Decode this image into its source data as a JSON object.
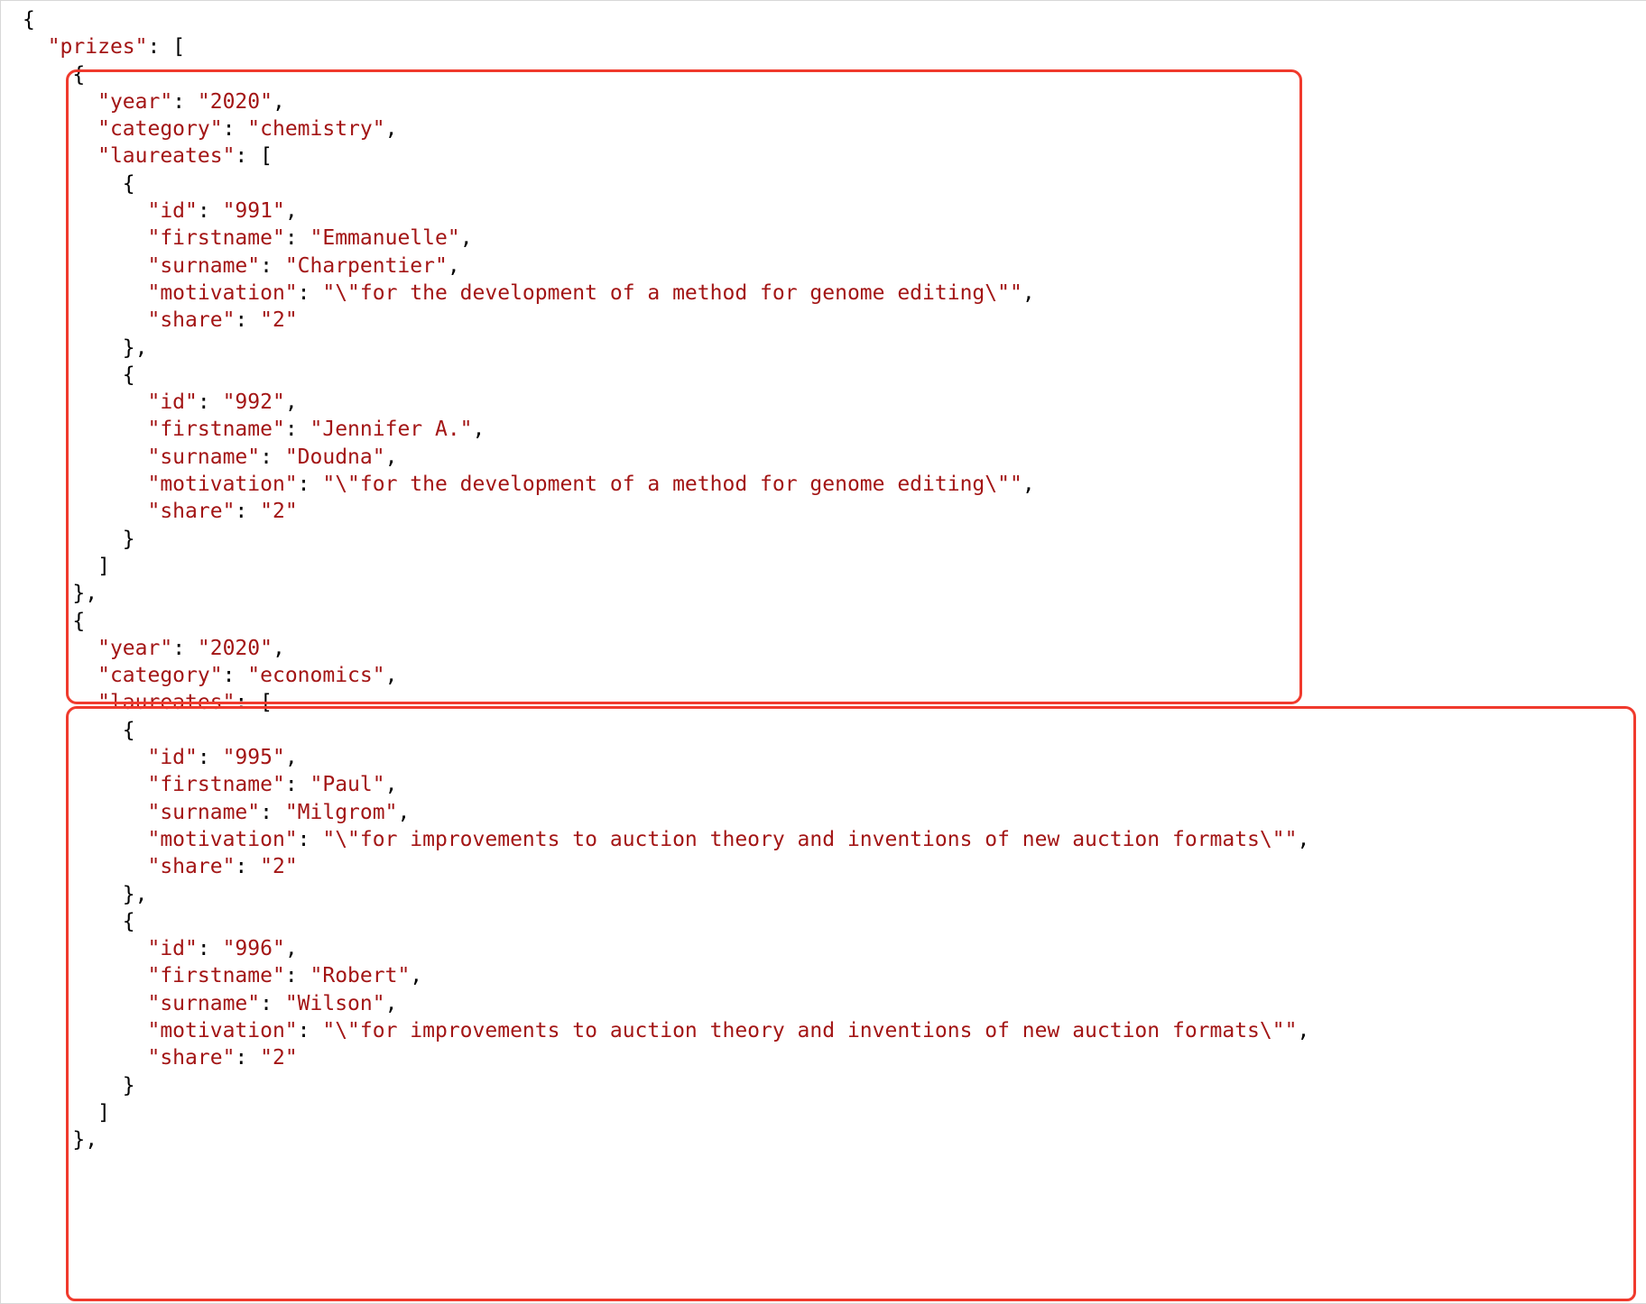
{
  "root_key": "\"prizes\"",
  "colors": {
    "highlight": "#f03a2d",
    "keystr": "#a31515"
  },
  "prizes": [
    {
      "year_key": "\"year\"",
      "year_val": "\"2020\"",
      "category_key": "\"category\"",
      "category_val": "\"chemistry\"",
      "laureates_key": "\"laureates\"",
      "laureates": [
        {
          "id_key": "\"id\"",
          "id_val": "\"991\"",
          "fn_key": "\"firstname\"",
          "fn_val": "\"Emmanuelle\"",
          "sn_key": "\"surname\"",
          "sn_val": "\"Charpentier\"",
          "mo_key": "\"motivation\"",
          "mo_val": "\"\\\"for the development of a method for genome editing\\\"\"",
          "sh_key": "\"share\"",
          "sh_val": "\"2\""
        },
        {
          "id_key": "\"id\"",
          "id_val": "\"992\"",
          "fn_key": "\"firstname\"",
          "fn_val": "\"Jennifer A.\"",
          "sn_key": "\"surname\"",
          "sn_val": "\"Doudna\"",
          "mo_key": "\"motivation\"",
          "mo_val": "\"\\\"for the development of a method for genome editing\\\"\"",
          "sh_key": "\"share\"",
          "sh_val": "\"2\""
        }
      ]
    },
    {
      "year_key": "\"year\"",
      "year_val": "\"2020\"",
      "category_key": "\"category\"",
      "category_val": "\"economics\"",
      "laureates_key": "\"laureates\"",
      "laureates": [
        {
          "id_key": "\"id\"",
          "id_val": "\"995\"",
          "fn_key": "\"firstname\"",
          "fn_val": "\"Paul\"",
          "sn_key": "\"surname\"",
          "sn_val": "\"Milgrom\"",
          "mo_key": "\"motivation\"",
          "mo_val": "\"\\\"for improvements to auction theory and inventions of new auction formats\\\"\"",
          "sh_key": "\"share\"",
          "sh_val": "\"2\""
        },
        {
          "id_key": "\"id\"",
          "id_val": "\"996\"",
          "fn_key": "\"firstname\"",
          "fn_val": "\"Robert\"",
          "sn_key": "\"surname\"",
          "sn_val": "\"Wilson\"",
          "mo_key": "\"motivation\"",
          "mo_val": "\"\\\"for improvements to auction theory and inventions of new auction formats\\\"\"",
          "sh_key": "\"share\"",
          "sh_val": "\"2\""
        }
      ]
    }
  ],
  "p": {
    "col": ": ",
    "com": ",",
    "ob": "{",
    "cb": "}",
    "obr": "[",
    "cbr": "]"
  }
}
